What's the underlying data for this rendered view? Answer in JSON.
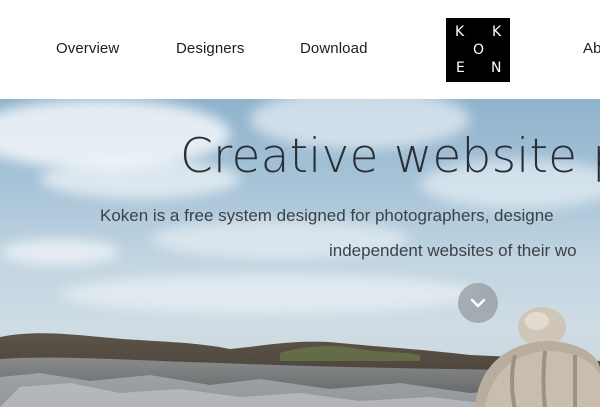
{
  "nav": {
    "items": [
      {
        "label": "Overview"
      },
      {
        "label": "Designers"
      },
      {
        "label": "Download"
      },
      {
        "label": "Ab"
      }
    ]
  },
  "logo": {
    "letters": [
      "K",
      "K",
      "O",
      "E",
      "N"
    ],
    "icon": "koken-logo"
  },
  "hero": {
    "title": "Creative website pu",
    "subtitle_line1": "Koken is a free system designed for photographers, designe",
    "subtitle_line2": "independent websites of their wo",
    "scroll_icon": "chevron-down-icon"
  },
  "colors": {
    "logo_bg": "#000000",
    "nav_text": "#1d1d1d",
    "title_text": "#2a2f35",
    "scroll_button": "#969ba0"
  }
}
